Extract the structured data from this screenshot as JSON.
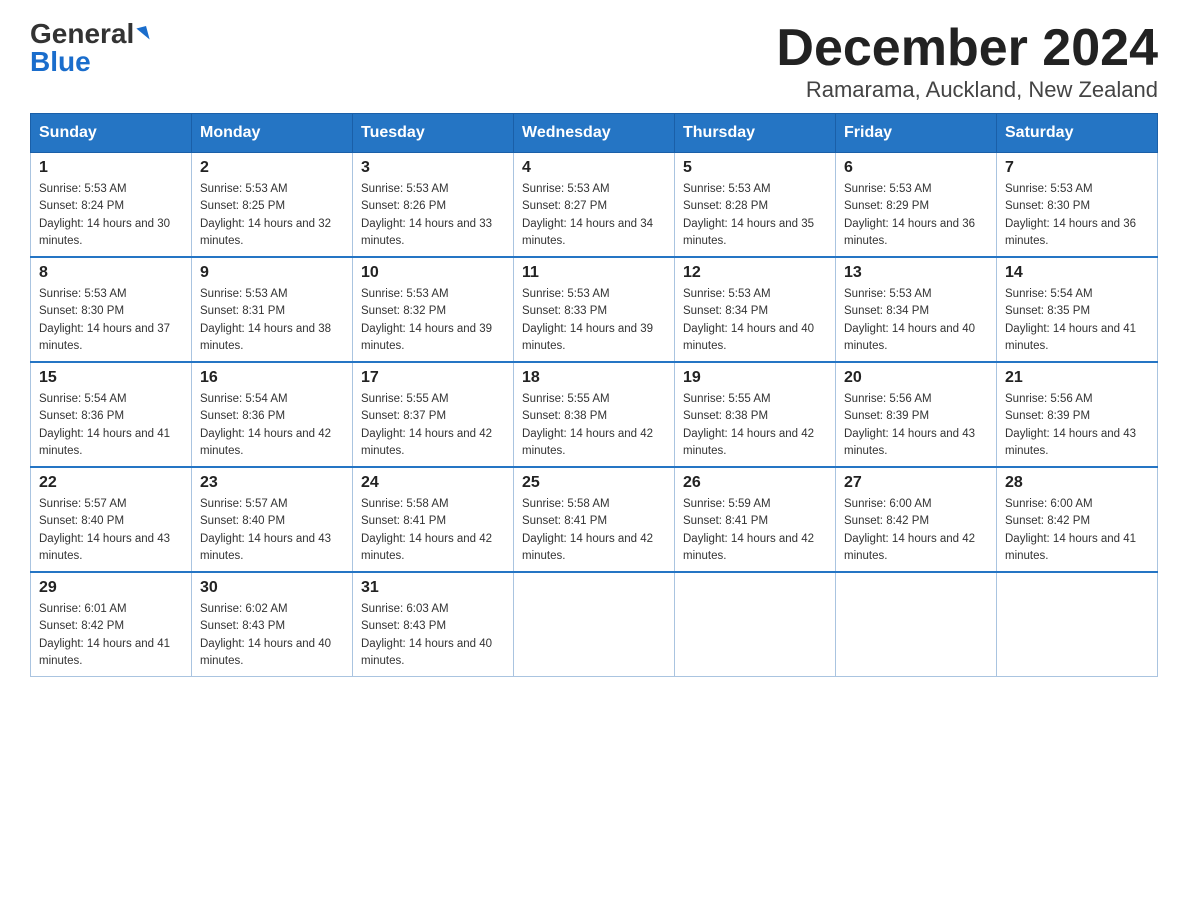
{
  "header": {
    "logo_general": "General",
    "logo_blue": "Blue",
    "month_title": "December 2024",
    "location": "Ramarama, Auckland, New Zealand"
  },
  "days_of_week": [
    "Sunday",
    "Monday",
    "Tuesday",
    "Wednesday",
    "Thursday",
    "Friday",
    "Saturday"
  ],
  "weeks": [
    [
      {
        "num": "1",
        "sunrise": "5:53 AM",
        "sunset": "8:24 PM",
        "daylight": "14 hours and 30 minutes."
      },
      {
        "num": "2",
        "sunrise": "5:53 AM",
        "sunset": "8:25 PM",
        "daylight": "14 hours and 32 minutes."
      },
      {
        "num": "3",
        "sunrise": "5:53 AM",
        "sunset": "8:26 PM",
        "daylight": "14 hours and 33 minutes."
      },
      {
        "num": "4",
        "sunrise": "5:53 AM",
        "sunset": "8:27 PM",
        "daylight": "14 hours and 34 minutes."
      },
      {
        "num": "5",
        "sunrise": "5:53 AM",
        "sunset": "8:28 PM",
        "daylight": "14 hours and 35 minutes."
      },
      {
        "num": "6",
        "sunrise": "5:53 AM",
        "sunset": "8:29 PM",
        "daylight": "14 hours and 36 minutes."
      },
      {
        "num": "7",
        "sunrise": "5:53 AM",
        "sunset": "8:30 PM",
        "daylight": "14 hours and 36 minutes."
      }
    ],
    [
      {
        "num": "8",
        "sunrise": "5:53 AM",
        "sunset": "8:30 PM",
        "daylight": "14 hours and 37 minutes."
      },
      {
        "num": "9",
        "sunrise": "5:53 AM",
        "sunset": "8:31 PM",
        "daylight": "14 hours and 38 minutes."
      },
      {
        "num": "10",
        "sunrise": "5:53 AM",
        "sunset": "8:32 PM",
        "daylight": "14 hours and 39 minutes."
      },
      {
        "num": "11",
        "sunrise": "5:53 AM",
        "sunset": "8:33 PM",
        "daylight": "14 hours and 39 minutes."
      },
      {
        "num": "12",
        "sunrise": "5:53 AM",
        "sunset": "8:34 PM",
        "daylight": "14 hours and 40 minutes."
      },
      {
        "num": "13",
        "sunrise": "5:53 AM",
        "sunset": "8:34 PM",
        "daylight": "14 hours and 40 minutes."
      },
      {
        "num": "14",
        "sunrise": "5:54 AM",
        "sunset": "8:35 PM",
        "daylight": "14 hours and 41 minutes."
      }
    ],
    [
      {
        "num": "15",
        "sunrise": "5:54 AM",
        "sunset": "8:36 PM",
        "daylight": "14 hours and 41 minutes."
      },
      {
        "num": "16",
        "sunrise": "5:54 AM",
        "sunset": "8:36 PM",
        "daylight": "14 hours and 42 minutes."
      },
      {
        "num": "17",
        "sunrise": "5:55 AM",
        "sunset": "8:37 PM",
        "daylight": "14 hours and 42 minutes."
      },
      {
        "num": "18",
        "sunrise": "5:55 AM",
        "sunset": "8:38 PM",
        "daylight": "14 hours and 42 minutes."
      },
      {
        "num": "19",
        "sunrise": "5:55 AM",
        "sunset": "8:38 PM",
        "daylight": "14 hours and 42 minutes."
      },
      {
        "num": "20",
        "sunrise": "5:56 AM",
        "sunset": "8:39 PM",
        "daylight": "14 hours and 43 minutes."
      },
      {
        "num": "21",
        "sunrise": "5:56 AM",
        "sunset": "8:39 PM",
        "daylight": "14 hours and 43 minutes."
      }
    ],
    [
      {
        "num": "22",
        "sunrise": "5:57 AM",
        "sunset": "8:40 PM",
        "daylight": "14 hours and 43 minutes."
      },
      {
        "num": "23",
        "sunrise": "5:57 AM",
        "sunset": "8:40 PM",
        "daylight": "14 hours and 43 minutes."
      },
      {
        "num": "24",
        "sunrise": "5:58 AM",
        "sunset": "8:41 PM",
        "daylight": "14 hours and 42 minutes."
      },
      {
        "num": "25",
        "sunrise": "5:58 AM",
        "sunset": "8:41 PM",
        "daylight": "14 hours and 42 minutes."
      },
      {
        "num": "26",
        "sunrise": "5:59 AM",
        "sunset": "8:41 PM",
        "daylight": "14 hours and 42 minutes."
      },
      {
        "num": "27",
        "sunrise": "6:00 AM",
        "sunset": "8:42 PM",
        "daylight": "14 hours and 42 minutes."
      },
      {
        "num": "28",
        "sunrise": "6:00 AM",
        "sunset": "8:42 PM",
        "daylight": "14 hours and 41 minutes."
      }
    ],
    [
      {
        "num": "29",
        "sunrise": "6:01 AM",
        "sunset": "8:42 PM",
        "daylight": "14 hours and 41 minutes."
      },
      {
        "num": "30",
        "sunrise": "6:02 AM",
        "sunset": "8:43 PM",
        "daylight": "14 hours and 40 minutes."
      },
      {
        "num": "31",
        "sunrise": "6:03 AM",
        "sunset": "8:43 PM",
        "daylight": "14 hours and 40 minutes."
      },
      null,
      null,
      null,
      null
    ]
  ]
}
